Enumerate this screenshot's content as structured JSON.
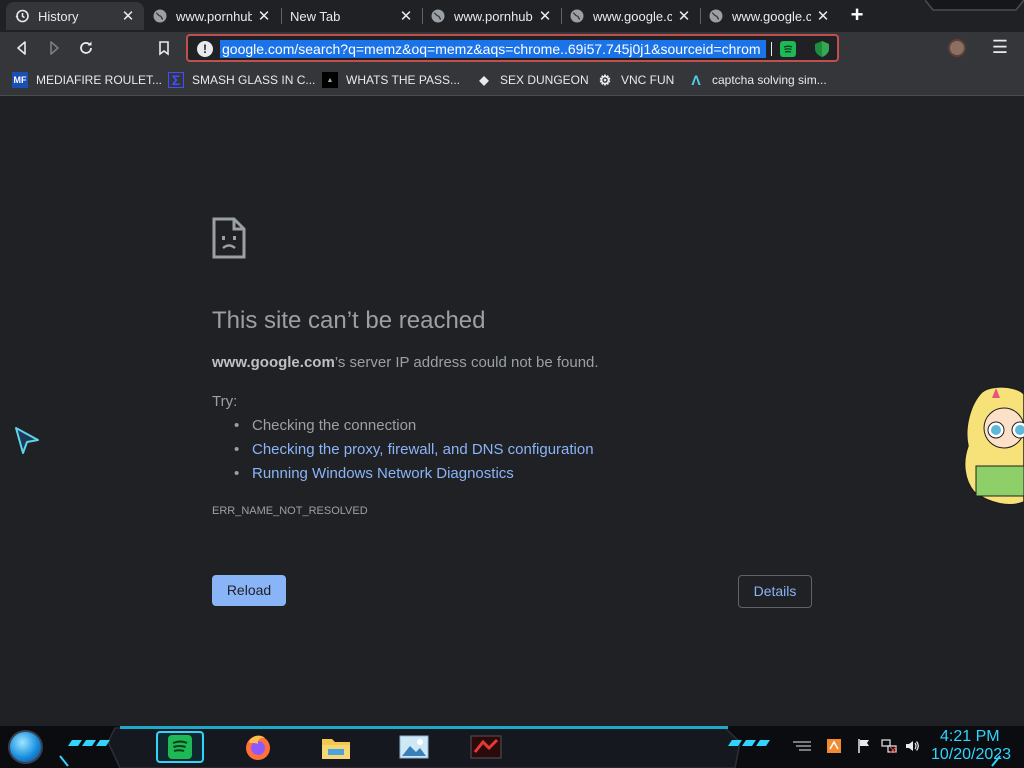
{
  "tabs": [
    {
      "title": "History",
      "icon": "history-icon",
      "active": true
    },
    {
      "title": "www.pornhub.c",
      "icon": "globe-icon",
      "active": false
    },
    {
      "title": "New Tab",
      "icon": "none",
      "active": false
    },
    {
      "title": "www.pornhub.c",
      "icon": "globe-icon",
      "active": false
    },
    {
      "title": "www.google.co",
      "icon": "globe-icon",
      "active": false
    },
    {
      "title": "www.google.co",
      "icon": "globe-icon",
      "active": false
    }
  ],
  "tab_close_glyph": "✕",
  "new_tab_glyph": "+",
  "omnibox": {
    "url": "google.com/search?q=memz&oq=memz&aqs=chrome..69i57.745j0j1&sourceid=chrom",
    "alert_glyph": "!"
  },
  "bookmarks": [
    {
      "label": "MEDIAFIRE ROULET...",
      "icon": "mediafire-icon",
      "icon_text": "MF"
    },
    {
      "label": "SMASH GLASS IN C...",
      "icon": "sigma-icon",
      "icon_text": "Σ"
    },
    {
      "label": "WHATS THE PASS...",
      "icon": "lock-icon",
      "icon_text": "▲"
    },
    {
      "label": "SEX DUNGEON",
      "icon": "creeper-icon",
      "icon_text": "◆"
    },
    {
      "label": "VNC FUN",
      "icon": "gear-icon",
      "icon_text": "⚙"
    },
    {
      "label": "captcha solving sim...",
      "icon": "caret-icon",
      "icon_text": "Λ"
    }
  ],
  "error": {
    "title": "This site can’t be reached",
    "host": "www.google.com",
    "desc_rest": "’s server IP address could not be found.",
    "try_label": "Try:",
    "suggestions": [
      {
        "text": "Checking the connection",
        "link": false
      },
      {
        "text": "Checking the proxy, firewall, and DNS configuration",
        "link": true
      },
      {
        "text": "Running Windows Network Diagnostics",
        "link": true
      }
    ],
    "code": "ERR_NAME_NOT_RESOLVED",
    "reload_label": "Reload",
    "details_label": "Details"
  },
  "taskbar": {
    "time": "4:21 PM",
    "date": "10/20/2023",
    "apps": [
      "spotify-icon",
      "firefox-icon",
      "file-explorer-icon",
      "photos-icon",
      "game-icon"
    ]
  },
  "colors": {
    "accent": "#8ab4f8",
    "clock": "#2fd5ff",
    "omnibox_border": "#c0504d",
    "selection": "#1a73e8"
  }
}
